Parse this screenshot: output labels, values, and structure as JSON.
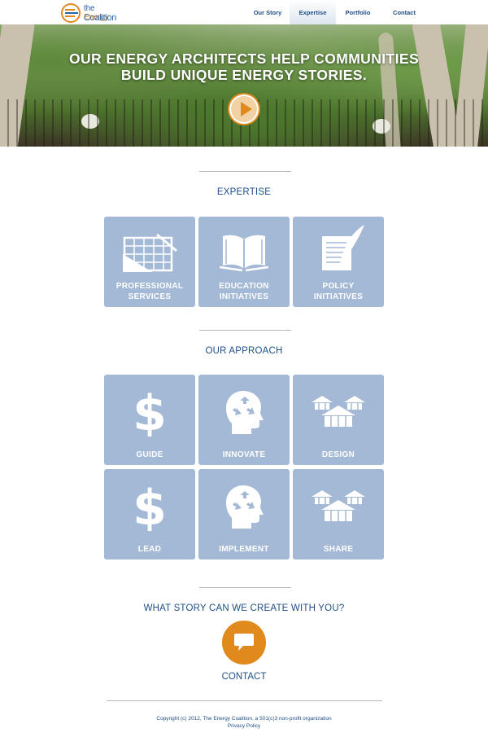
{
  "brand": {
    "logo_line1_prefix": "the",
    "logo_line1": "Energy",
    "logo_line2": "Coalition"
  },
  "nav": {
    "items": [
      {
        "label": "Our Story",
        "active": false
      },
      {
        "label": "Expertise",
        "active": true
      },
      {
        "label": "Portfolio",
        "active": false
      },
      {
        "label": "Contact",
        "active": false
      }
    ]
  },
  "hero": {
    "title_line1": "OUR ENERGY ARCHITECTS HELP COMMUNITIES",
    "title_line2": "BUILD UNIQUE ENERGY STORIES.",
    "play_icon": "play-icon"
  },
  "expertise": {
    "title": "EXPERTISE",
    "tiles": [
      {
        "line1": "PROFESSIONAL",
        "line2": "SERVICES",
        "icon": "blueprint-icon"
      },
      {
        "line1": "EDUCATION",
        "line2": "INITIATIVES",
        "icon": "open-book-icon"
      },
      {
        "line1": "POLICY",
        "line2": "INITIATIVES",
        "icon": "document-quill-icon"
      }
    ]
  },
  "approach": {
    "title": "OUR APPROACH",
    "tiles": [
      {
        "label": "GUIDE",
        "icon": "dollar-icon"
      },
      {
        "label": "INNOVATE",
        "icon": "head-recycle-icon"
      },
      {
        "label": "DESIGN",
        "icon": "gazebos-icon"
      },
      {
        "label": "LEAD",
        "icon": "dollar-icon"
      },
      {
        "label": "IMPLEMENT",
        "icon": "head-recycle-icon"
      },
      {
        "label": "SHARE",
        "icon": "gazebos-icon"
      }
    ]
  },
  "cta": {
    "question": "WHAT STORY CAN WE CREATE WITH YOU?",
    "contact_label": "CONTACT",
    "icon": "speech-bubble-icon"
  },
  "footer": {
    "copyright": "Copyright (c) 2012, The Energy Coalition, a 501(c)3 non-profit organization",
    "privacy": "Privacy Policy"
  },
  "colors": {
    "accent": "#e08a1e",
    "brand_blue": "#1f4f86",
    "tile": "#a3b9d6"
  }
}
